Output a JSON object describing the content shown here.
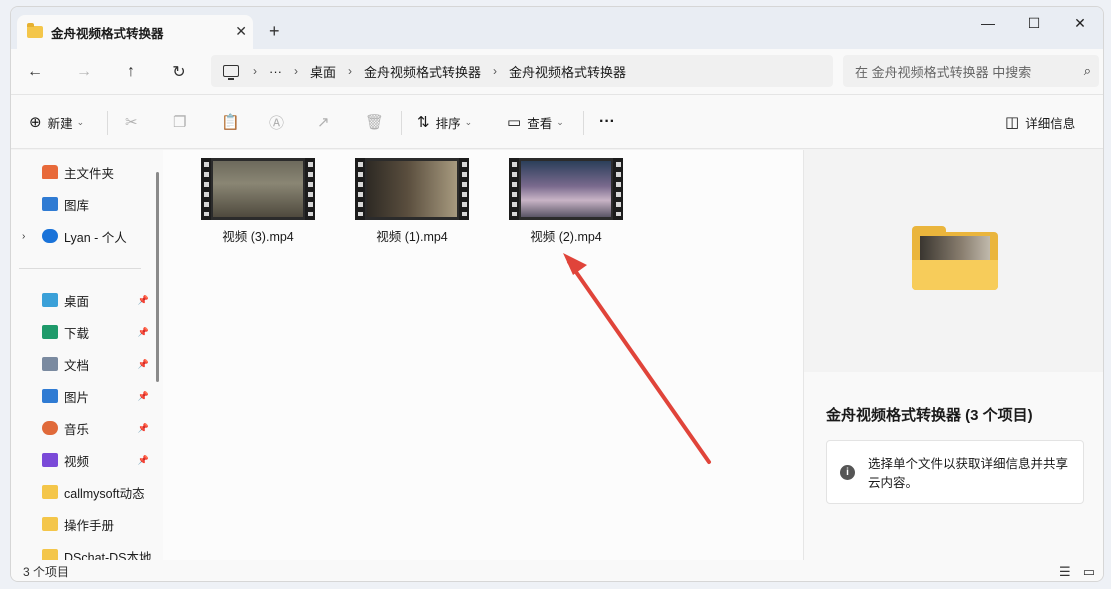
{
  "window": {
    "tab_title": "金舟视频格式转换器",
    "tab_close": "✕",
    "new_tab": "+"
  },
  "controls": {
    "minimize": "—",
    "maximize": "☐",
    "close": "✕"
  },
  "nav": {
    "back": "←",
    "forward": "→",
    "up": "↑",
    "refresh": "↻",
    "more": "···",
    "breadcrumbs": [
      "桌面",
      "金舟视频格式转换器",
      "金舟视频格式转换器"
    ],
    "sep": "›",
    "search_placeholder": "在 金舟视频格式转换器 中搜索",
    "search_icon": "⌕"
  },
  "toolbar": {
    "new_label": "新建",
    "sort_label": "排序",
    "view_label": "查看",
    "more": "···",
    "details_label": "详细信息",
    "chevron": "⌄"
  },
  "sidebar": {
    "items": [
      {
        "label": "主文件夹",
        "icon": "home-icon"
      },
      {
        "label": "图库",
        "icon": "gallery-icon"
      },
      {
        "label": "Lyan - 个人",
        "icon": "onedrive-icon"
      },
      {
        "label": "桌面",
        "icon": "desktop-icon"
      },
      {
        "label": "下载",
        "icon": "download-icon"
      },
      {
        "label": "文档",
        "icon": "documents-icon"
      },
      {
        "label": "图片",
        "icon": "pictures-icon"
      },
      {
        "label": "音乐",
        "icon": "music-icon"
      },
      {
        "label": "视频",
        "icon": "videos-icon"
      },
      {
        "label": "callmysoft动态",
        "icon": "folder-icon"
      },
      {
        "label": "操作手册",
        "icon": "folder-icon"
      },
      {
        "label": "DSchat-DS本地",
        "icon": "folder-icon"
      }
    ],
    "pin": "📌"
  },
  "files": [
    {
      "name": "视频 (3).mp4"
    },
    {
      "name": "视频 (1).mp4"
    },
    {
      "name": "视频 (2).mp4"
    }
  ],
  "details": {
    "title": "金舟视频格式转换器 (3 个项目)",
    "info_text": "选择单个文件以获取详细信息并共享云内容。",
    "info_icon": "i"
  },
  "status": {
    "count": "3 个项目"
  },
  "colors": {
    "accent": "#0067c0",
    "arrow": "#e0443a",
    "folder": "#f4c64a"
  }
}
